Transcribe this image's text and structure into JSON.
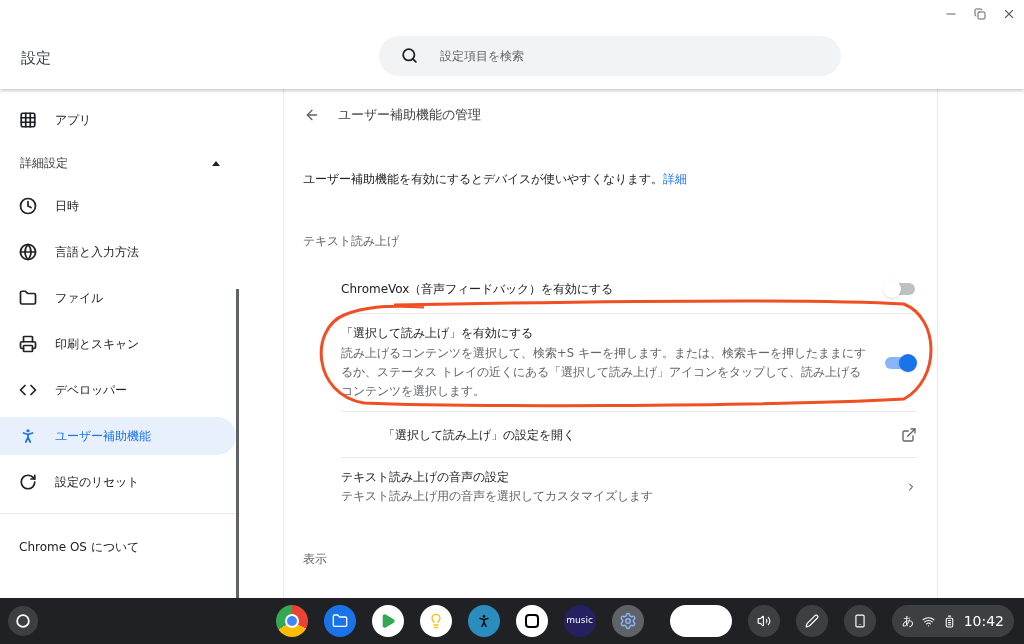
{
  "header": {
    "title": "設定",
    "search": {
      "placeholder": "設定項目を検索"
    }
  },
  "sidebar": {
    "items": [
      {
        "kind": "item",
        "label": "アプリ",
        "selected": false
      },
      {
        "kind": "section",
        "label": "詳細設定",
        "expanded": true
      },
      {
        "kind": "item",
        "label": "日時",
        "selected": false
      },
      {
        "kind": "item",
        "label": "言語と入力方法",
        "selected": false
      },
      {
        "kind": "item",
        "label": "ファイル",
        "selected": false
      },
      {
        "kind": "item",
        "label": "印刷とスキャン",
        "selected": false
      },
      {
        "kind": "item",
        "label": "デベロッパー",
        "selected": false
      },
      {
        "kind": "item",
        "label": "ユーザー補助機能",
        "selected": true
      },
      {
        "kind": "item",
        "label": "設定のリセット",
        "selected": false
      },
      {
        "kind": "about",
        "label": "Chrome OS について"
      }
    ]
  },
  "page": {
    "title": "ユーザー補助機能の管理",
    "intro": "ユーザー補助機能を有効にするとデバイスが使いやすくなります。",
    "intro_link": "詳細",
    "sections": [
      {
        "heading": "テキスト読み上げ",
        "rows": [
          {
            "kind": "toggle",
            "title": "ChromeVox（音声フィードバック）を有効にする",
            "on": false
          },
          {
            "kind": "toggle",
            "title": "「選択して読み上げ」を有効にする",
            "description": "読み上げるコンテンツを選択して、検索+S キーを押します。または、検索キーを押したままにするか、ステータス トレイの近くにある「選択して読み上げ」アイコンをタップして、読み上げるコンテンツを選択します。",
            "on": true
          },
          {
            "kind": "external",
            "title": "「選択して読み上げ」の設定を開く"
          },
          {
            "kind": "subpage",
            "title": "テキスト読み上げの音声の設定",
            "description": "テキスト読み上げ用の音声を選択してカスタマイズします"
          }
        ]
      },
      {
        "heading": "表示"
      }
    ]
  },
  "shelf": {
    "apps": [
      {
        "kind": "chrome"
      },
      {
        "kind": "files"
      },
      {
        "kind": "play"
      },
      {
        "kind": "keep"
      },
      {
        "kind": "kindle"
      },
      {
        "kind": "notion"
      },
      {
        "kind": "music",
        "label": "music"
      },
      {
        "kind": "settings"
      }
    ],
    "ime": "あ",
    "time": "10:42"
  }
}
